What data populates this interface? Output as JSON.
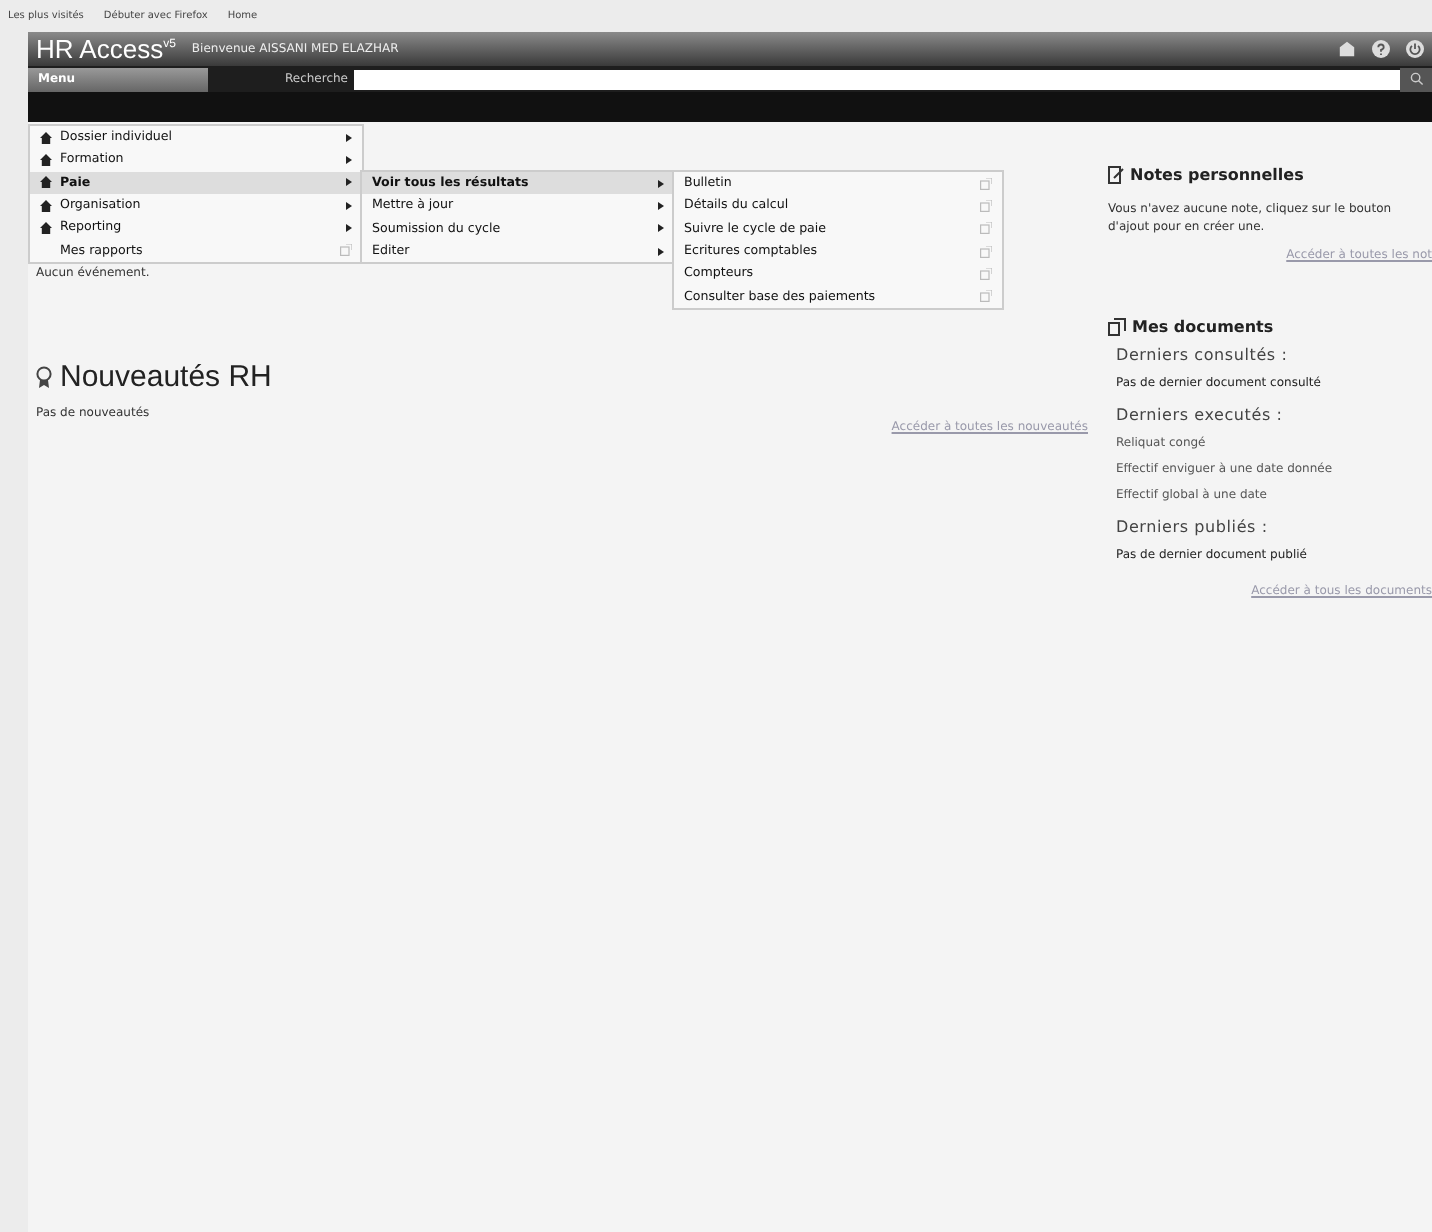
{
  "bookmarks": [
    "Les plus visités",
    "Débuter avec Firefox",
    "Home"
  ],
  "header": {
    "logo": "HR Access",
    "logo_mark": "v5",
    "welcome": "Bienvenue AISSANI MED ELAZHAR"
  },
  "menu_button": "Menu",
  "search": {
    "label": "Recherche"
  },
  "menu": [
    {
      "label": "Dossier individuel",
      "kind": "submenu",
      "icon": true,
      "selected": false
    },
    {
      "label": "Formation",
      "kind": "submenu",
      "icon": true,
      "selected": false
    },
    {
      "label": "Paie",
      "kind": "submenu",
      "icon": true,
      "selected": true
    },
    {
      "label": "Organisation",
      "kind": "submenu",
      "icon": true,
      "selected": false
    },
    {
      "label": "Reporting",
      "kind": "submenu",
      "icon": true,
      "selected": false
    },
    {
      "label": "Mes rapports",
      "kind": "external",
      "icon": false,
      "selected": false
    }
  ],
  "submenu": [
    {
      "label": "Voir tous les résultats",
      "kind": "submenu",
      "selected": true
    },
    {
      "label": "Mettre à jour",
      "kind": "submenu",
      "selected": false
    },
    {
      "label": "Soumission du cycle",
      "kind": "submenu",
      "selected": false
    },
    {
      "label": "Editer",
      "kind": "submenu",
      "selected": false
    }
  ],
  "submenu2": [
    {
      "label": "Bulletin",
      "kind": "external",
      "selected": false
    },
    {
      "label": "Détails du calcul",
      "kind": "external",
      "selected": false
    },
    {
      "label": "Suivre le cycle de paie",
      "kind": "external",
      "selected": false
    },
    {
      "label": "Ecritures comptables",
      "kind": "external",
      "selected": false
    },
    {
      "label": "Compteurs",
      "kind": "external",
      "selected": false
    },
    {
      "label": "Consulter base des paiements",
      "kind": "external",
      "selected": false
    }
  ],
  "events_text": "Aucun événement.",
  "news": {
    "title": "Nouveautés RH",
    "text": "Pas de nouveautés",
    "link": "Accéder à toutes les nouveautés"
  },
  "notes": {
    "title": "Notes personnelles",
    "text": "Vous n'avez aucune note, cliquez sur le bouton d'ajout pour en créer une.",
    "link": "Accéder à toutes les not"
  },
  "documents": {
    "title": "Mes documents",
    "sections": [
      {
        "title": "Derniers consultés :",
        "items": [
          {
            "label": "Pas de dernier document consulté",
            "kind": "empty"
          }
        ]
      },
      {
        "title": "Derniers executés :",
        "items": [
          {
            "label": "Reliquat congé",
            "kind": "link"
          },
          {
            "label": "Effectif enviguer à une date donnée",
            "kind": "link"
          },
          {
            "label": "Effectif global à une date",
            "kind": "link"
          }
        ]
      },
      {
        "title": "Derniers publiés :",
        "items": [
          {
            "label": "Pas de dernier document publié",
            "kind": "empty"
          }
        ]
      }
    ],
    "link": "Accéder à tous les documents"
  }
}
